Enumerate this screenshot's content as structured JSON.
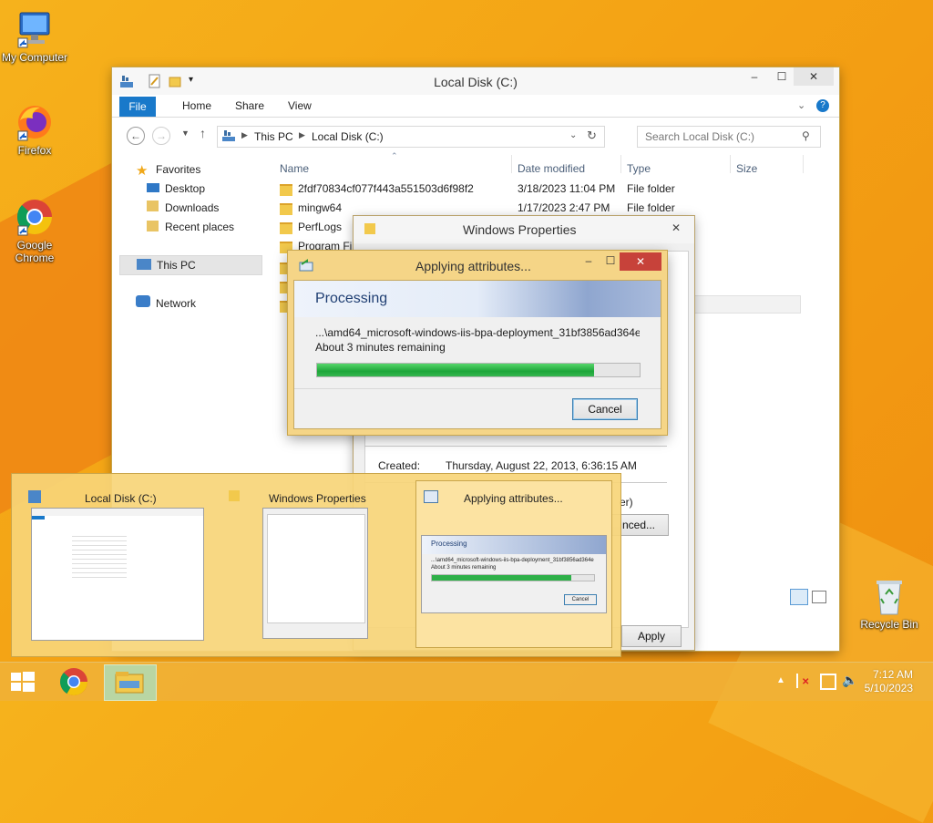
{
  "desktop": {
    "icons": [
      {
        "label": "My Computer"
      },
      {
        "label": "Firefox"
      },
      {
        "label": "Google Chrome"
      },
      {
        "label": "Recycle Bin"
      }
    ]
  },
  "explorer": {
    "title": "Local Disk (C:)",
    "tabs": [
      "File",
      "Home",
      "Share",
      "View"
    ],
    "breadcrumb": [
      "This PC",
      "Local Disk (C:)"
    ],
    "search_placeholder": "Search Local Disk (C:)",
    "nav": {
      "favorites": "Favorites",
      "desktop": "Desktop",
      "downloads": "Downloads",
      "recent": "Recent places",
      "thispc": "This PC",
      "network": "Network"
    },
    "columns": {
      "name": "Name",
      "date": "Date modified",
      "type": "Type",
      "size": "Size"
    },
    "rows": [
      {
        "name": "2fdf70834cf077f443a551503d6f98f2",
        "date": "3/18/2023 11:04 PM",
        "type": "File folder"
      },
      {
        "name": "mingw64",
        "date": "1/17/2023 2:47 PM",
        "type": "File folder"
      },
      {
        "name": "PerfLogs",
        "date": "",
        "type": ""
      },
      {
        "name": "Program Fi",
        "date": "",
        "type": ""
      }
    ]
  },
  "properties": {
    "title": "Windows Properties",
    "created_label": "Created:",
    "created_value": "Thursday, August 22, 2013, 6:36:15 AM",
    "fragment_er": "er)",
    "advanced_fragment": "nced...",
    "apply": "Apply"
  },
  "progress": {
    "title": "Applying attributes...",
    "banner": "Processing",
    "file": "...\\amd64_microsoft-windows-iis-bpa-deployment_31bf3856ad364e",
    "remaining": "About 3 minutes remaining",
    "progress_fraction": 0.86,
    "cancel": "Cancel"
  },
  "thumbnails": [
    {
      "caption": "Local Disk (C:)"
    },
    {
      "caption": "Windows Properties"
    },
    {
      "caption": "Applying attributes...",
      "processing": "Processing",
      "file": "...\\amd64_microsoft-windows-iis-bpa-deployment_31bf3856ad364e",
      "remaining": "About 3 minutes remaining",
      "cancel": "Cancel"
    }
  ],
  "taskbar": {
    "clock_time": "7:12 AM",
    "clock_date": "5/10/2023"
  }
}
